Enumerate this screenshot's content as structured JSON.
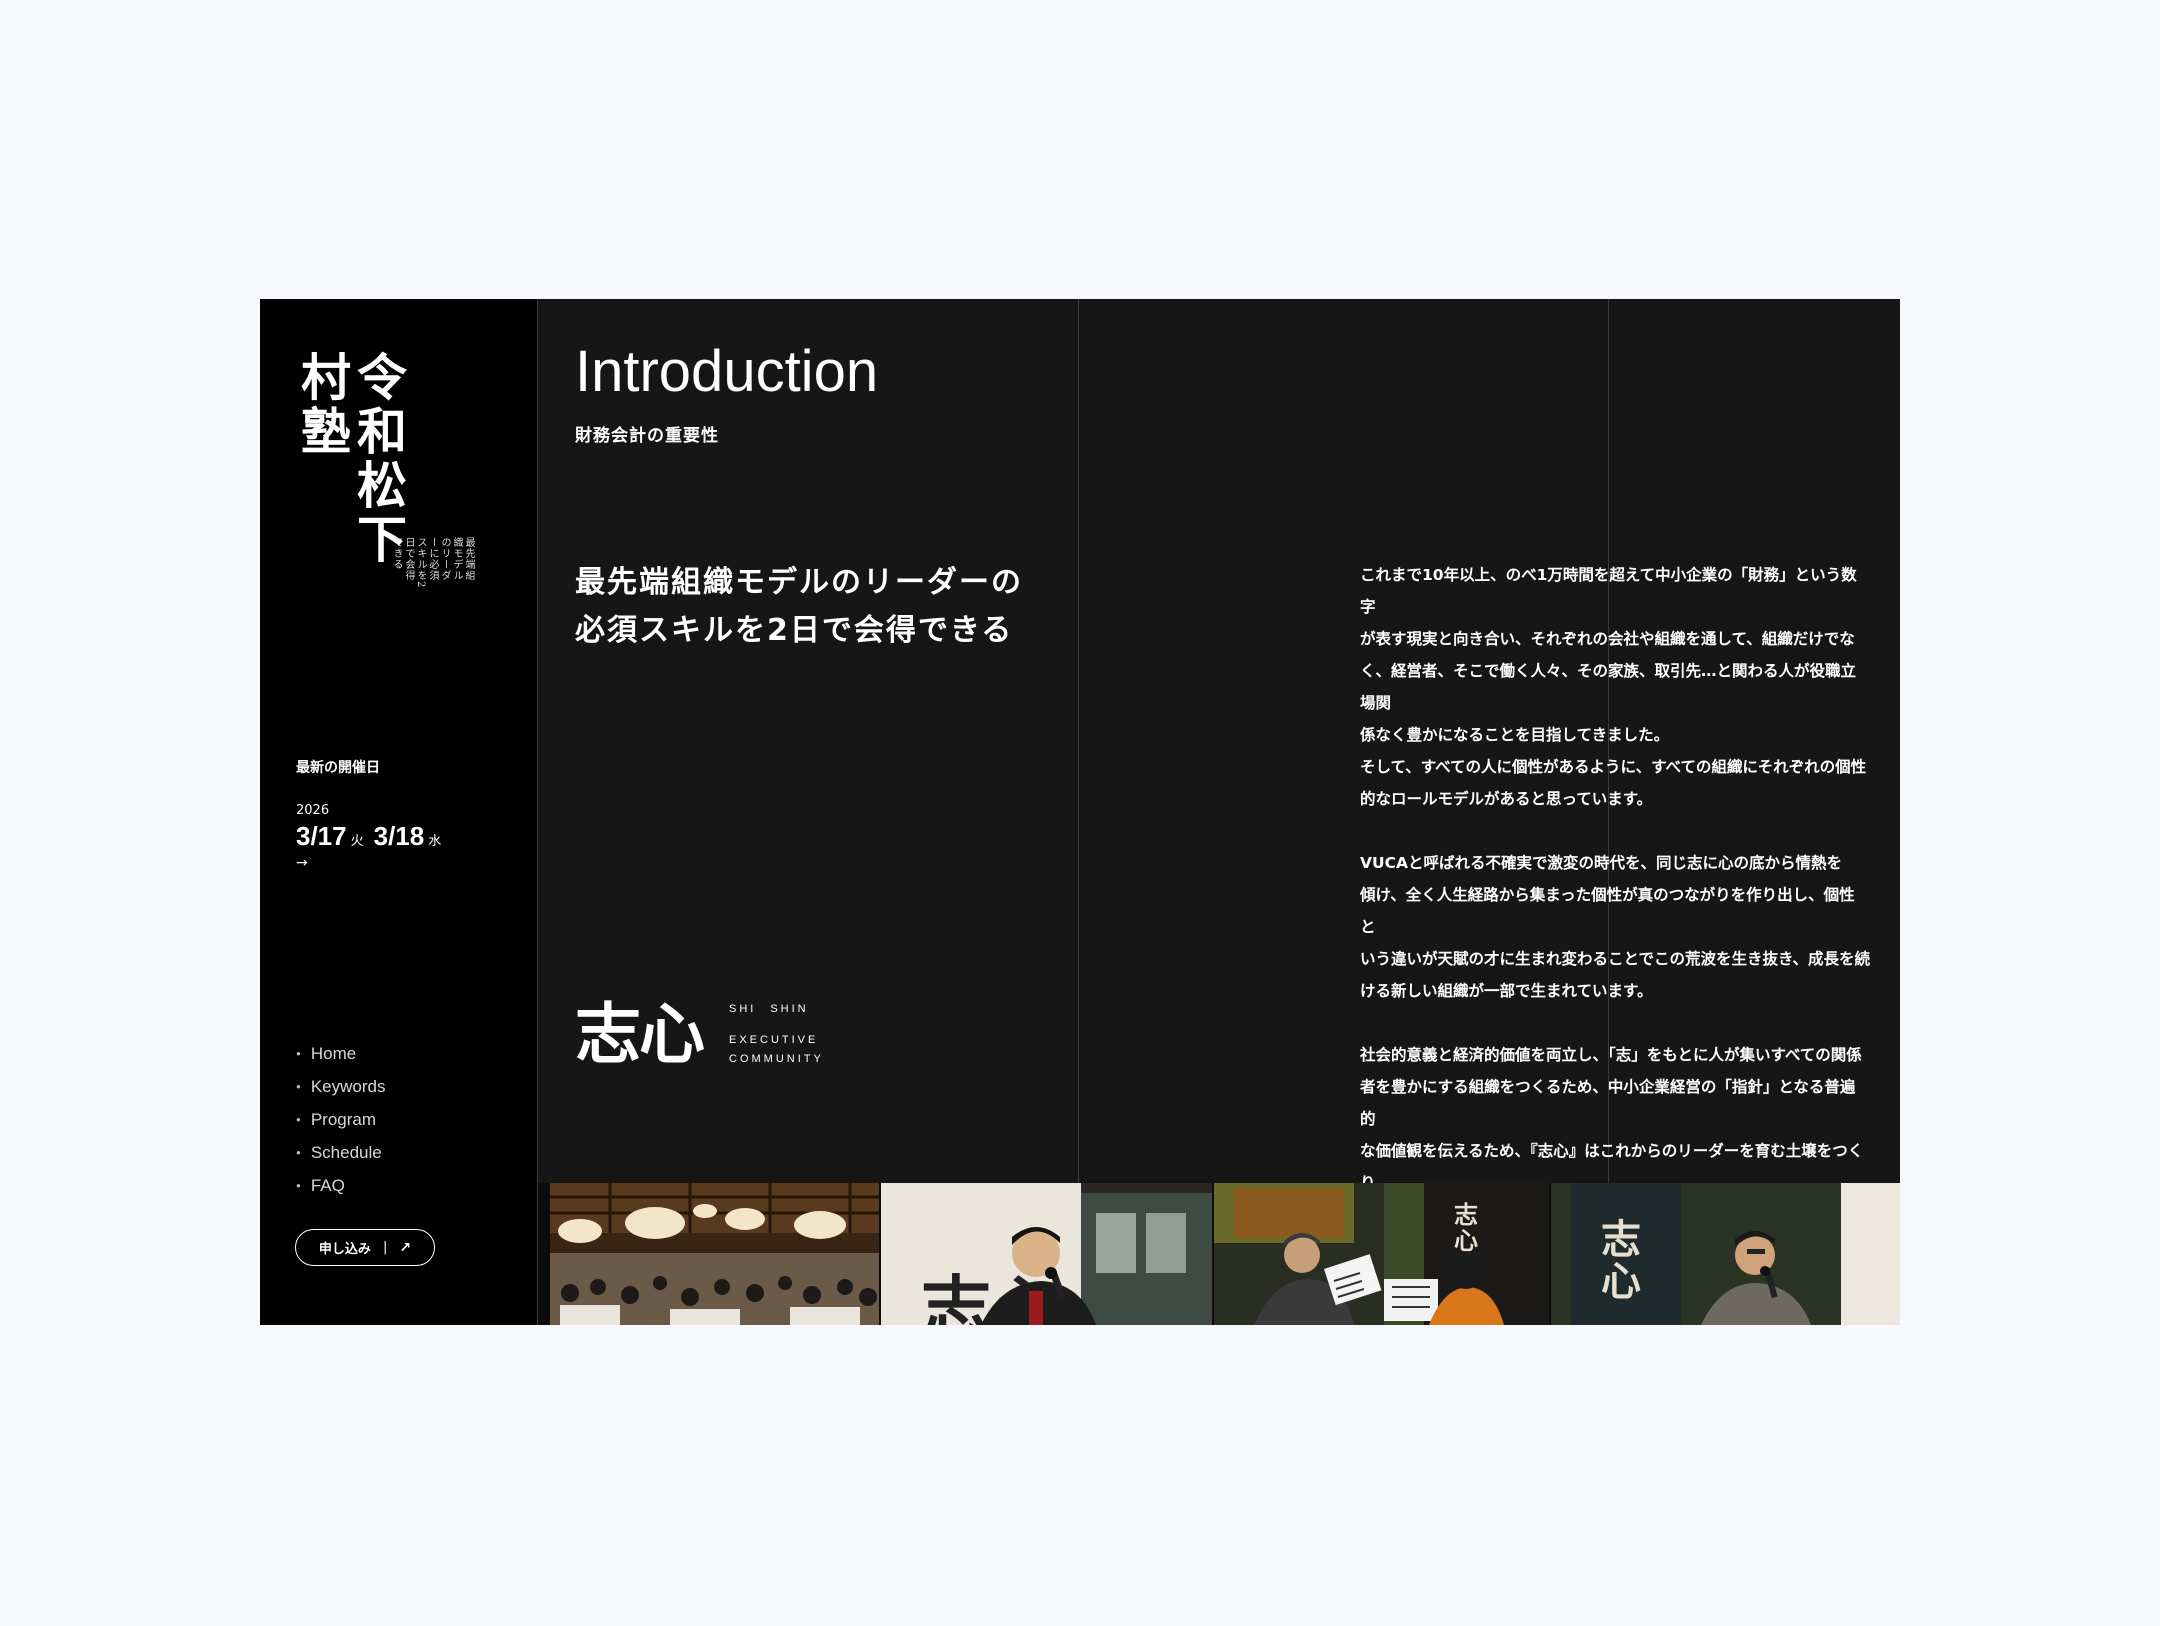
{
  "sidebar": {
    "brand_main": "令和松下村塾",
    "brand_sub": "最先端組織モデルのリーダーに必須スキルを2日で会得できる",
    "date_label": "最新の開催日",
    "date_year": "2026",
    "date1": "3/17",
    "dow1": "火",
    "date2": "3/18",
    "dow2": "水",
    "date_arrow": "→",
    "nav": [
      "Home",
      "Keywords",
      "Program",
      "Schedule",
      "FAQ"
    ],
    "apply_label": "申し込み",
    "apply_sep": "|",
    "apply_arrow": "↗"
  },
  "main": {
    "title": "Introduction",
    "subtitle": "財務会計の重要性",
    "lead_line1": "最先端組織モデルのリーダーの",
    "lead_line2": "必須スキルを2日で会得できる",
    "logo_mark": "志心",
    "logo_line1": "SHI　SHIN",
    "logo_line2": "EXECUTIVE",
    "logo_line3": "COMMUNITY",
    "paragraphs": [
      "これまで10年以上、のべ1万時間を超えて中小企業の「財務」という数字\nが表す現実と向き合い、それぞれの会社や組織を通して、組織だけでな\nく、経営者、そこで働く人々、その家族、取引先…と関わる人が役職立場関\n係なく豊かになることを目指してきました。\nそして、すべての人に個性があるように、すべての組織にそれぞれの個性\n的なロールモデルがあると思っています。",
      "VUCAと呼ばれる不確実で激変の時代を、同じ志に心の底から情熱を\n傾け、全く人生経路から集まった個性が真のつながりを作り出し、個性と\nいう違いが天賦の才に生まれ変わることでこの荒波を生き抜き、成長を続\nける新しい組織が一部で生まれています。",
      "社会的意義と経済的価値を両立し、「志」をもとに人が集いすべての関係\n者を豊かにする組織をつくるため、中小企業経営の「指針」となる普遍的\nな価値観を伝えるため、『志心』はこれからのリーダーを育む土壌をつくり\nます。"
    ]
  },
  "photos": {
    "banner_text": "志心",
    "colors": {
      "accent": "#ffffff",
      "bg": "#161616",
      "sidebar": "#000000",
      "page": "#f7f8fb"
    }
  }
}
